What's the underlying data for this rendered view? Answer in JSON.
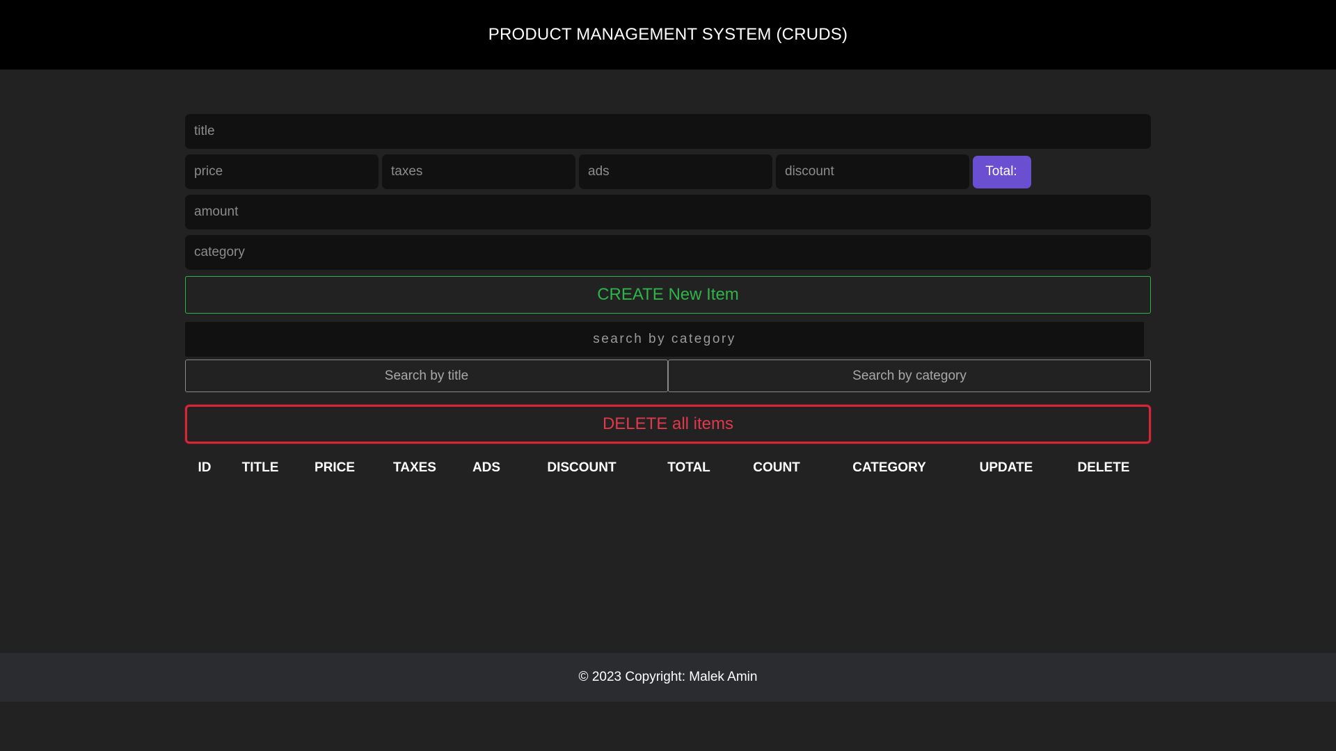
{
  "header": {
    "title": "PRODUCT MANAGEMENT SYSTEM (CRUDS)"
  },
  "form": {
    "title_placeholder": "title",
    "price_placeholder": "price",
    "taxes_placeholder": "taxes",
    "ads_placeholder": "ads",
    "discount_placeholder": "discount",
    "total_label": "Total:",
    "total_value": "",
    "amount_placeholder": "amount",
    "category_placeholder": "category",
    "create_button": "CREATE New Item"
  },
  "search": {
    "placeholder": "search by category",
    "by_title_button": "Search by title",
    "by_category_button": "Search by category"
  },
  "actions": {
    "delete_all_button": "DELETE all items"
  },
  "table": {
    "headers": [
      "ID",
      "TITLE",
      "PRICE",
      "TAXES",
      "ADS",
      "DISCOUNT",
      "TOTAL",
      "COUNT",
      "CATEGORY",
      "UPDATE",
      "DELETE"
    ],
    "rows": []
  },
  "footer": {
    "copyright": "© 2023 Copyright: Malek Amin"
  },
  "colors": {
    "header_bg": "#000000",
    "page_bg": "#222222",
    "input_bg": "#111111",
    "total_bg": "#6a4fd1",
    "create_green": "#2fb44a",
    "delete_red": "#d2283a",
    "footer_bg": "#2a2c30"
  }
}
